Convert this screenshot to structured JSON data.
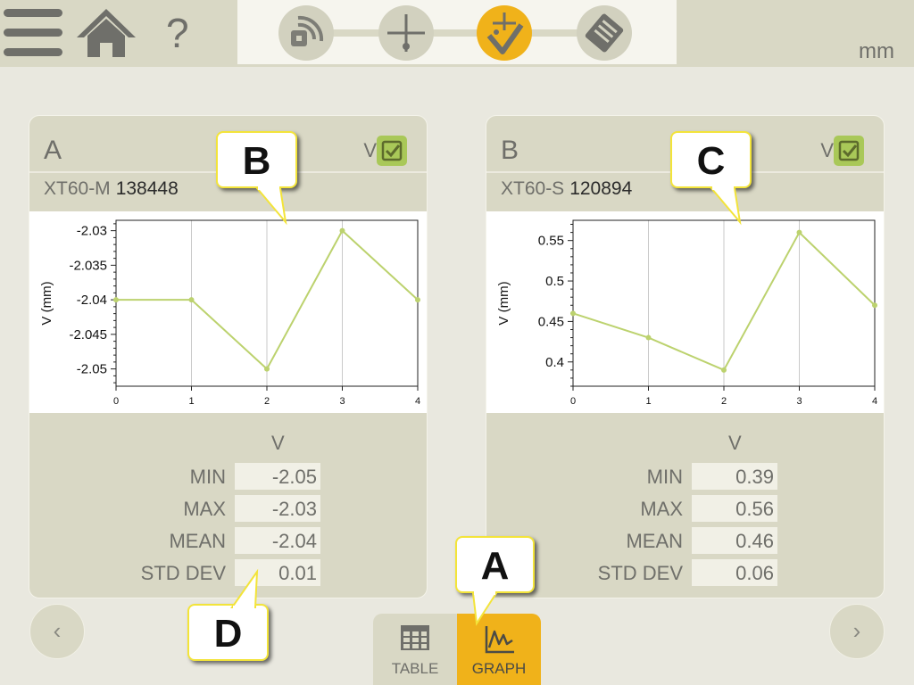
{
  "header": {
    "unit": "mm",
    "menu_icon": "hamburger-menu-icon",
    "home_icon": "home-icon",
    "help_label": "?",
    "steps": [
      {
        "icon": "wireless-sensor-icon",
        "active": false
      },
      {
        "icon": "crosshair-icon",
        "active": false
      },
      {
        "icon": "measure-icon",
        "active": true
      },
      {
        "icon": "save-file-icon",
        "active": false
      }
    ]
  },
  "cards": [
    {
      "letter": "A",
      "checkbox_label": "V",
      "checked": true,
      "sensor_model": "XT60-M",
      "sensor_id": "138448",
      "stats": {
        "title": "V",
        "rows": [
          {
            "label": "MIN",
            "value": "-2.05"
          },
          {
            "label": "MAX",
            "value": "-2.03"
          },
          {
            "label": "MEAN",
            "value": "-2.04"
          },
          {
            "label": "STD DEV",
            "value": "0.01"
          }
        ]
      }
    },
    {
      "letter": "B",
      "checkbox_label": "V",
      "checked": true,
      "sensor_model": "XT60-S",
      "sensor_id": "120894",
      "stats": {
        "title": "V",
        "rows": [
          {
            "label": "MIN",
            "value": "0.39"
          },
          {
            "label": "MAX",
            "value": "0.56"
          },
          {
            "label": "MEAN",
            "value": "0.46"
          },
          {
            "label": "STD DEV",
            "value": "0.06"
          }
        ]
      }
    }
  ],
  "chart_data": [
    {
      "type": "line",
      "x": [
        0,
        1,
        2,
        3,
        4
      ],
      "values": [
        -2.04,
        -2.04,
        -2.05,
        -2.03,
        -2.04
      ],
      "ylabel": "V (mm)",
      "xlim": [
        0,
        4
      ],
      "ylim": [
        -2.0525,
        -2.0285
      ],
      "yticks": [
        "-2.03",
        "-2.035",
        "-2.04",
        "-2.045",
        "-2.05"
      ],
      "ytick_values": [
        -2.03,
        -2.035,
        -2.04,
        -2.045,
        -2.05
      ],
      "xticks": [
        "0",
        "1",
        "2",
        "3",
        "4"
      ],
      "grid": "vertical",
      "line_color": "#bcd26e"
    },
    {
      "type": "line",
      "x": [
        0,
        1,
        2,
        3,
        4
      ],
      "values": [
        0.46,
        0.43,
        0.39,
        0.56,
        0.47
      ],
      "ylabel": "V (mm)",
      "xlim": [
        0,
        4
      ],
      "ylim": [
        0.37,
        0.575
      ],
      "yticks": [
        "0.55",
        "0.5",
        "0.45",
        "0.4"
      ],
      "ytick_values": [
        0.55,
        0.5,
        0.45,
        0.4
      ],
      "xticks": [
        "0",
        "1",
        "2",
        "3",
        "4"
      ],
      "grid": "vertical",
      "line_color": "#bcd26e"
    }
  ],
  "nav": {
    "prev_label": "‹",
    "next_label": "›"
  },
  "tabs": [
    {
      "label": "TABLE",
      "icon": "table-icon",
      "active": false
    },
    {
      "label": "GRAPH",
      "icon": "graph-icon",
      "active": true
    }
  ],
  "callouts": [
    {
      "label": "B"
    },
    {
      "label": "C"
    },
    {
      "label": "D"
    },
    {
      "label": "A"
    }
  ],
  "colors": {
    "accent": "#f0b21a",
    "check": "#a9c858",
    "line": "#bcd26e",
    "panel": "#d9d8c5"
  }
}
